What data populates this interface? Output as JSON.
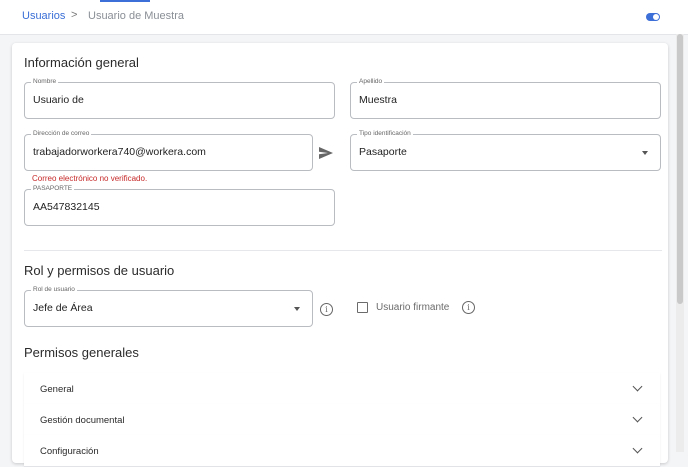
{
  "breadcrumb": {
    "root": "Usuarios",
    "separator": ">",
    "current": "Usuario de Muestra"
  },
  "sections": {
    "general_info": "Información general",
    "roles": "Rol y permisos de usuario",
    "permissions": "Permisos generales"
  },
  "form": {
    "nombre": {
      "label": "Nombre",
      "value": "Usuario de"
    },
    "apellido": {
      "label": "Apellido",
      "value": "Muestra"
    },
    "correo": {
      "label": "Dirección de correo",
      "value": "trabajadorworkera740@workera.com"
    },
    "correo_error": "Correo electrónico no verificado.",
    "tipo_id": {
      "label": "Tipo identificación",
      "value": "Pasaporte"
    },
    "pasaporte": {
      "label": "PASAPORTE",
      "value": "AA547832145"
    },
    "rol": {
      "label": "Rol de usuario",
      "value": "Jefe de Área"
    },
    "firmante": {
      "label": "Usuario firmante",
      "checked": false
    }
  },
  "accordions": [
    "General",
    "Gestión documental",
    "Configuración"
  ],
  "icons": {
    "send": "send-icon",
    "info": "info-icon",
    "toggle": "toggle-icon"
  },
  "colors": {
    "accent": "#3d6fd8",
    "error": "#c62828"
  }
}
